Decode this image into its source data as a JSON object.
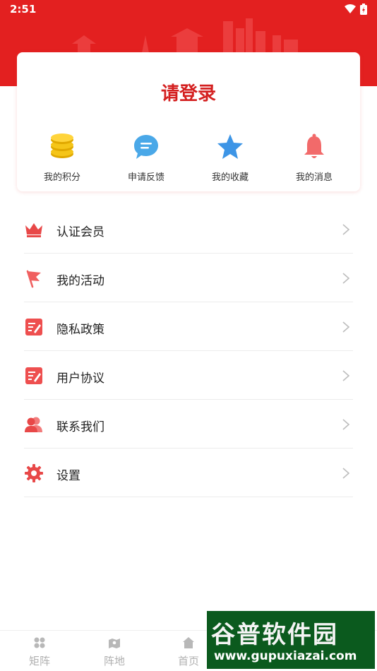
{
  "status_bar": {
    "time": "2:51"
  },
  "login": {
    "title": "请登录"
  },
  "quick_actions": [
    {
      "label": "我的积分",
      "icon": "coins-icon"
    },
    {
      "label": "申请反馈",
      "icon": "chat-bubble-icon"
    },
    {
      "label": "我的收藏",
      "icon": "star-icon"
    },
    {
      "label": "我的消息",
      "icon": "bell-icon"
    }
  ],
  "menu": [
    {
      "label": "认证会员",
      "icon": "crown-icon"
    },
    {
      "label": "我的活动",
      "icon": "flag-icon"
    },
    {
      "label": "隐私政策",
      "icon": "document-edit-icon"
    },
    {
      "label": "用户协议",
      "icon": "document-edit-icon"
    },
    {
      "label": "联系我们",
      "icon": "users-icon"
    },
    {
      "label": "设置",
      "icon": "gear-icon"
    }
  ],
  "tabbar": [
    {
      "label": "矩阵",
      "icon": "grid-icon"
    },
    {
      "label": "阵地",
      "icon": "map-icon"
    },
    {
      "label": "首页",
      "icon": "home-icon"
    }
  ],
  "watermark": {
    "title": "谷普软件园",
    "url": "www.gupuxiazai.com"
  },
  "colors": {
    "brand_red": "#e32020",
    "title_red": "#d42020",
    "watermark_green": "#0b5a1e"
  }
}
